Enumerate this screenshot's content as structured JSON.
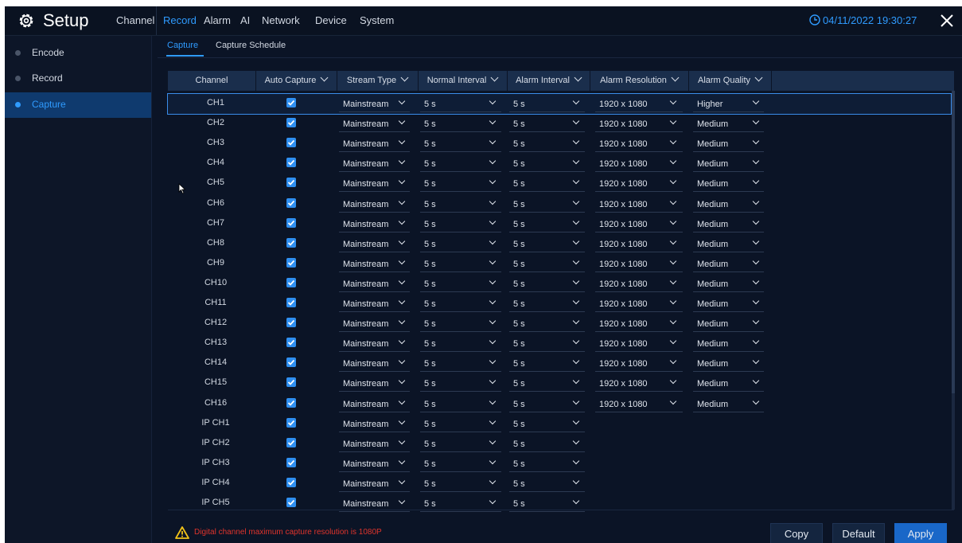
{
  "header": {
    "title": "Setup",
    "datetime": "04/11/2022 19:30:27",
    "nav": [
      "Channel",
      "Record",
      "Alarm",
      "AI",
      "Network",
      "Device",
      "System"
    ],
    "active_nav": "Record"
  },
  "sidebar": {
    "items": [
      {
        "label": "Encode"
      },
      {
        "label": "Record"
      },
      {
        "label": "Capture"
      }
    ],
    "active": "Capture"
  },
  "subtabs": {
    "items": [
      "Capture",
      "Capture Schedule"
    ],
    "active": "Capture"
  },
  "table": {
    "columns": [
      "Channel",
      "Auto Capture",
      "Stream Type",
      "Normal Interval",
      "Alarm Interval",
      "Alarm Resolution",
      "Alarm Quality"
    ],
    "rows": [
      {
        "channel": "CH1",
        "auto_capture": true,
        "stream_type": "Mainstream",
        "normal_interval": "5 s",
        "alarm_interval": "5 s",
        "alarm_resolution": "1920 x 1080",
        "alarm_quality": "Higher"
      },
      {
        "channel": "CH2",
        "auto_capture": true,
        "stream_type": "Mainstream",
        "normal_interval": "5 s",
        "alarm_interval": "5 s",
        "alarm_resolution": "1920 x 1080",
        "alarm_quality": "Medium"
      },
      {
        "channel": "CH3",
        "auto_capture": true,
        "stream_type": "Mainstream",
        "normal_interval": "5 s",
        "alarm_interval": "5 s",
        "alarm_resolution": "1920 x 1080",
        "alarm_quality": "Medium"
      },
      {
        "channel": "CH4",
        "auto_capture": true,
        "stream_type": "Mainstream",
        "normal_interval": "5 s",
        "alarm_interval": "5 s",
        "alarm_resolution": "1920 x 1080",
        "alarm_quality": "Medium"
      },
      {
        "channel": "CH5",
        "auto_capture": true,
        "stream_type": "Mainstream",
        "normal_interval": "5 s",
        "alarm_interval": "5 s",
        "alarm_resolution": "1920 x 1080",
        "alarm_quality": "Medium"
      },
      {
        "channel": "CH6",
        "auto_capture": true,
        "stream_type": "Mainstream",
        "normal_interval": "5 s",
        "alarm_interval": "5 s",
        "alarm_resolution": "1920 x 1080",
        "alarm_quality": "Medium"
      },
      {
        "channel": "CH7",
        "auto_capture": true,
        "stream_type": "Mainstream",
        "normal_interval": "5 s",
        "alarm_interval": "5 s",
        "alarm_resolution": "1920 x 1080",
        "alarm_quality": "Medium"
      },
      {
        "channel": "CH8",
        "auto_capture": true,
        "stream_type": "Mainstream",
        "normal_interval": "5 s",
        "alarm_interval": "5 s",
        "alarm_resolution": "1920 x 1080",
        "alarm_quality": "Medium"
      },
      {
        "channel": "CH9",
        "auto_capture": true,
        "stream_type": "Mainstream",
        "normal_interval": "5 s",
        "alarm_interval": "5 s",
        "alarm_resolution": "1920 x 1080",
        "alarm_quality": "Medium"
      },
      {
        "channel": "CH10",
        "auto_capture": true,
        "stream_type": "Mainstream",
        "normal_interval": "5 s",
        "alarm_interval": "5 s",
        "alarm_resolution": "1920 x 1080",
        "alarm_quality": "Medium"
      },
      {
        "channel": "CH11",
        "auto_capture": true,
        "stream_type": "Mainstream",
        "normal_interval": "5 s",
        "alarm_interval": "5 s",
        "alarm_resolution": "1920 x 1080",
        "alarm_quality": "Medium"
      },
      {
        "channel": "CH12",
        "auto_capture": true,
        "stream_type": "Mainstream",
        "normal_interval": "5 s",
        "alarm_interval": "5 s",
        "alarm_resolution": "1920 x 1080",
        "alarm_quality": "Medium"
      },
      {
        "channel": "CH13",
        "auto_capture": true,
        "stream_type": "Mainstream",
        "normal_interval": "5 s",
        "alarm_interval": "5 s",
        "alarm_resolution": "1920 x 1080",
        "alarm_quality": "Medium"
      },
      {
        "channel": "CH14",
        "auto_capture": true,
        "stream_type": "Mainstream",
        "normal_interval": "5 s",
        "alarm_interval": "5 s",
        "alarm_resolution": "1920 x 1080",
        "alarm_quality": "Medium"
      },
      {
        "channel": "CH15",
        "auto_capture": true,
        "stream_type": "Mainstream",
        "normal_interval": "5 s",
        "alarm_interval": "5 s",
        "alarm_resolution": "1920 x 1080",
        "alarm_quality": "Medium"
      },
      {
        "channel": "CH16",
        "auto_capture": true,
        "stream_type": "Mainstream",
        "normal_interval": "5 s",
        "alarm_interval": "5 s",
        "alarm_resolution": "1920 x 1080",
        "alarm_quality": "Medium"
      },
      {
        "channel": "IP CH1",
        "auto_capture": true,
        "stream_type": "Mainstream",
        "normal_interval": "5 s",
        "alarm_interval": "5 s",
        "alarm_resolution": "",
        "alarm_quality": ""
      },
      {
        "channel": "IP CH2",
        "auto_capture": true,
        "stream_type": "Mainstream",
        "normal_interval": "5 s",
        "alarm_interval": "5 s",
        "alarm_resolution": "",
        "alarm_quality": ""
      },
      {
        "channel": "IP CH3",
        "auto_capture": true,
        "stream_type": "Mainstream",
        "normal_interval": "5 s",
        "alarm_interval": "5 s",
        "alarm_resolution": "",
        "alarm_quality": ""
      },
      {
        "channel": "IP CH4",
        "auto_capture": true,
        "stream_type": "Mainstream",
        "normal_interval": "5 s",
        "alarm_interval": "5 s",
        "alarm_resolution": "",
        "alarm_quality": ""
      },
      {
        "channel": "IP CH5",
        "auto_capture": true,
        "stream_type": "Mainstream",
        "normal_interval": "5 s",
        "alarm_interval": "5 s",
        "alarm_resolution": "",
        "alarm_quality": ""
      }
    ]
  },
  "footer": {
    "warning": "Digital channel maximum capture resolution is 1080P",
    "buttons": {
      "copy": "Copy",
      "default": "Default",
      "apply": "Apply"
    }
  },
  "colors": {
    "accent": "#2f9bff",
    "warning": "#e0342c",
    "primary_button": "#1967c8",
    "background": "#0b1426"
  }
}
